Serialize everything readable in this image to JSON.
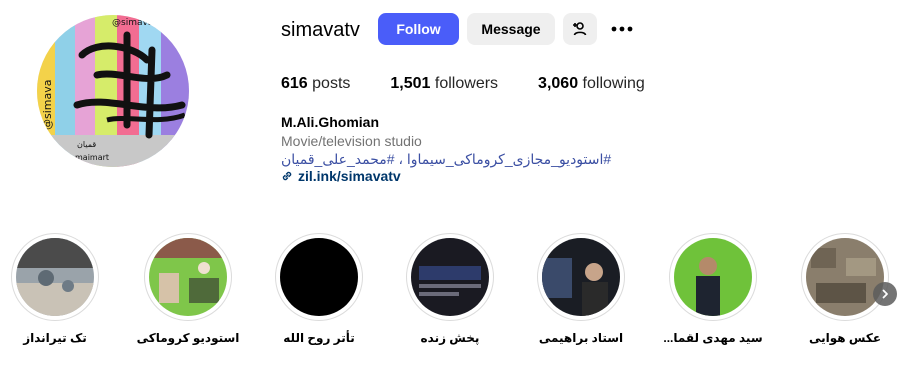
{
  "profile": {
    "username": "simavatv",
    "follow_label": "Follow",
    "message_label": "Message",
    "avatar_icon": "profile-avatar",
    "avatar_texts": {
      "handle_top": "@simava",
      "handle_side": "@simava",
      "brand_side": "قمیان",
      "brand_bottom": "maimart"
    },
    "stats": {
      "posts_count": "616",
      "posts_label": "posts",
      "followers_count": "1,501",
      "followers_label": "followers",
      "following_count": "3,060",
      "following_label": "following"
    },
    "full_name": "M.Ali.Ghomian",
    "category": "Movie/television studio",
    "hashtags": "#استودیو_مجازی_کروماکی_سیماوا ، #محمد_علی_قمیان",
    "link": "zil.ink/simavatv"
  },
  "highlights": [
    {
      "label": "تک تیرانداز"
    },
    {
      "label": "استودیو کروماکی"
    },
    {
      "label": "تأتر روح الله"
    },
    {
      "label": "پخش زنده"
    },
    {
      "label": "استاد براهیمی"
    },
    {
      "label": "سید مهدی لقما..."
    },
    {
      "label": "عکس هوایی"
    }
  ],
  "colors": {
    "follow_button": "#4a5df9",
    "secondary_button": "#efefef",
    "link": "#00376b",
    "hashtag": "#3b4fa3"
  }
}
